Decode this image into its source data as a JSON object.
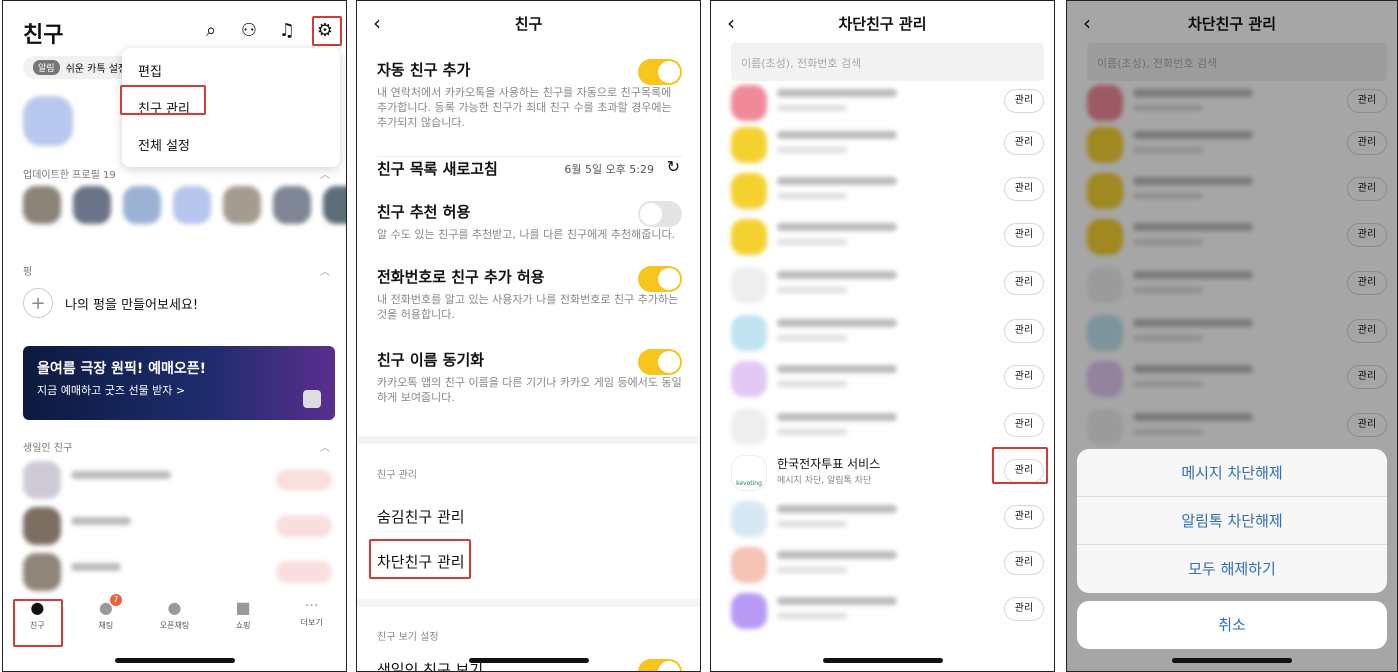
{
  "p1": {
    "title": "친구",
    "notice_badge": "알림",
    "notice_text": "쉬운 카톡 설정",
    "menu": [
      "편집",
      "친구 관리",
      "전체 설정"
    ],
    "updated_profiles": "업데이트한 프로필 19",
    "pyeong_section": "펑",
    "make_pyeong": "나의 펑을 만들어보세요!",
    "banner_title": "올여름 극장 원픽! 예매오픈!",
    "banner_sub": "지금 예매하고 굿즈 선물 받자 >",
    "birthday": "생일인 친구",
    "tabs": [
      "친구",
      "채팅",
      "오픈채팅",
      "쇼핑",
      "더보기"
    ],
    "chat_badge": "7"
  },
  "p2": {
    "title": "친구",
    "auto_add": "자동 친구 추가",
    "auto_add_desc": "내 연락처에서 카카오톡을 사용하는 친구를 자동으로 친구목록에 추가합니다. 등록 가능한 친구가 최대 친구 수를 초과할 경우에는 추가되지 않습니다.",
    "refresh": "친구 목록 새로고침",
    "refresh_time": "6월 5일 오후 5:29",
    "recommend": "친구 추천 허용",
    "recommend_desc": "알 수도 있는 친구를 추천받고, 나를 다른 친구에게 추천해줍니다.",
    "phone_add": "전화번호로 친구 추가 허용",
    "phone_add_desc": "내 전화번호를 알고 있는 사용자가 나를 전화번호로 친구 추가하는 것을 허용합니다.",
    "name_sync": "친구 이름 동기화",
    "name_sync_desc": "카카오톡 앱의 친구 이름을 다른 기기나 카카오 게임 등에서도 동일하게 보여줍니다.",
    "manage_section": "친구 관리",
    "hidden": "숨김친구 관리",
    "blocked": "차단친구 관리",
    "view_section": "친구 보기 설정",
    "birthday_view": "생일인 친구 보기"
  },
  "p3": {
    "title": "차단친구 관리",
    "search_placeholder": "이름(초성), 전화번호 검색",
    "manage": "관리",
    "kevoting_name": "한국전자투표 서비스",
    "kevoting_sub": "메시지 차단, 알림톡 차단",
    "kevoting_logo": "kevoting"
  },
  "p4": {
    "title": "차단친구 관리",
    "search_placeholder": "이름(초성), 전화번호 검색",
    "manage": "관리",
    "actions": [
      "메시지 차단해제",
      "알림톡 차단해제",
      "모두 해제하기"
    ],
    "cancel": "취소"
  },
  "colors": {
    "kakao_yellow": "#f7c51c",
    "highlight_red": "#d23b3b",
    "action_blue": "#2f6fb6"
  }
}
